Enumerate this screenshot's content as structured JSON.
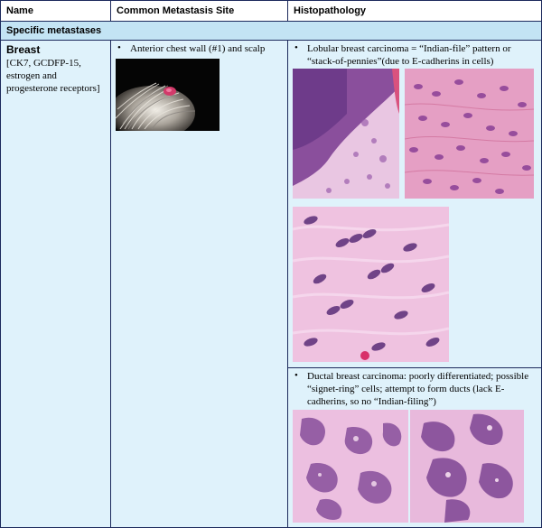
{
  "headers": {
    "name": "Name",
    "site": "Common Metastasis Site",
    "histo": "Histopathology"
  },
  "section_title": "Specific metastases",
  "row": {
    "name_title": "Breast",
    "markers": "[CK7, GCDFP-15, estrogen and progesterone receptors]",
    "site_bullet": "Anterior chest wall (#1) and scalp",
    "lobular_text": "Lobular breast carcinoma = “Indian-file” pattern or “stack-of-pennies”(due to E-cadherins in cells)",
    "ductal_text": "Ductal breast carcinoma: poorly differentiated; possible “signet-ring” cells; attempt to form ducts (lack E-cadherins, so no “Indian-filing”)"
  },
  "colors": {
    "border": "#1d2a5c",
    "cell_bg": "#dff2fb",
    "section_bg": "#c3e4f4",
    "stain_pink": "#e3a8d0",
    "stain_purple": "#7c4a9a"
  }
}
